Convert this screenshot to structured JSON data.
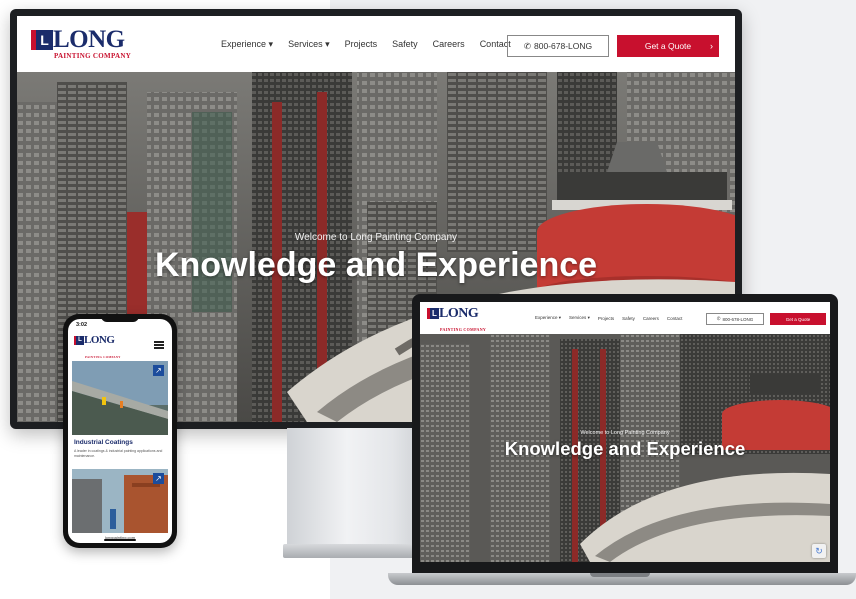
{
  "brand": {
    "name": "LONG",
    "subtitle": "PAINTING COMPANY",
    "colors": {
      "navy": "#1b2c6b",
      "red": "#c8102e"
    }
  },
  "nav": {
    "items": [
      {
        "label": "Experience",
        "has_dropdown": true
      },
      {
        "label": "Services",
        "has_dropdown": true
      },
      {
        "label": "Projects",
        "has_dropdown": false
      },
      {
        "label": "Safety",
        "has_dropdown": false
      },
      {
        "label": "Careers",
        "has_dropdown": false
      },
      {
        "label": "Contact",
        "has_dropdown": false
      }
    ],
    "phone_label": "800-678-LONG",
    "quote_label": "Get a Quote",
    "chevron": "▾"
  },
  "hero": {
    "eyebrow": "Welcome to Long Painting Company",
    "title": "Knowledge and Experience"
  },
  "mobile": {
    "status_time": "3:02",
    "card1": {
      "title": "Industrial Coatings",
      "text": "A leader in coatings & industrial painting applications and maintenance."
    },
    "url": "longpainting.com"
  },
  "icons": {
    "phone": "phone-icon",
    "menu": "hamburger-menu-icon",
    "expand": "arrow-expand-icon",
    "recaptcha": "recaptcha-icon"
  }
}
